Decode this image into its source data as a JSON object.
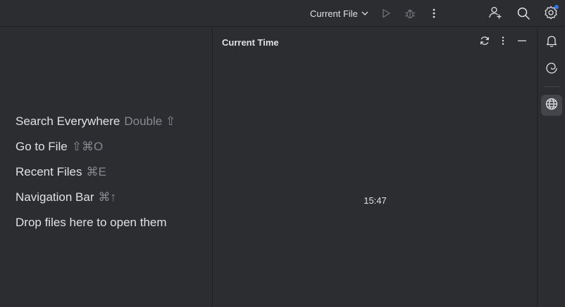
{
  "toolbar": {
    "run_config_label": "Current File"
  },
  "welcome_hints": [
    {
      "action": "Search Everywhere",
      "shortcut": "Double ⇧"
    },
    {
      "action": "Go to File",
      "shortcut": "⇧⌘O"
    },
    {
      "action": "Recent Files",
      "shortcut": "⌘E"
    },
    {
      "action": "Navigation Bar",
      "shortcut": "⌘↑"
    },
    {
      "action": "Drop files here to open them",
      "shortcut": ""
    }
  ],
  "tool_window": {
    "title": "Current Time",
    "time": "15:47"
  },
  "icons": {
    "run": "play-icon",
    "debug": "bug-icon",
    "more": "vertical-dots-icon",
    "code_with_me": "add-user-icon",
    "search": "search-icon",
    "settings": "gear-icon",
    "refresh": "refresh-icon",
    "minimize": "minimize-icon",
    "notifications": "bell-icon",
    "ai_assistant": "spiral-icon",
    "web": "globe-icon"
  },
  "colors": {
    "background": "#2b2d30",
    "text": "#dfe1e5",
    "muted_text": "#868991",
    "notification_dot": "#3574f0",
    "active_strip_button": "#43454a"
  }
}
